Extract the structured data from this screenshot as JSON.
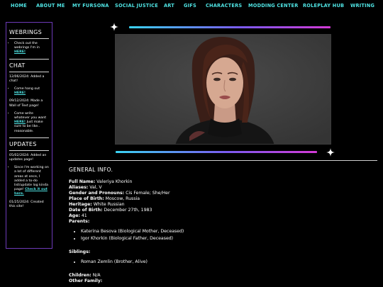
{
  "nav": {
    "items": [
      "HOME",
      "ABOUT ME",
      "MY FURSONA",
      "SOCIAL JUSTICE",
      "ART",
      "GIFS",
      "CHARACTERS",
      "MODDING CENTER",
      "ROLEPLAY HUB",
      "WRITING"
    ]
  },
  "sidebar": {
    "webrings": {
      "heading": "WEBRINGS",
      "item_text": "Check out the webrings I'm in",
      "item_link": "HERE!"
    },
    "chat": {
      "heading": "CHAT",
      "entry1_date_text": "12/06/2024: Added a chat!",
      "bullet1_text": "Come hang out",
      "bullet1_link": "HERE!",
      "entry2_date_text": "09/12/2024: Made a Wall of Text page!",
      "bullet2_text": "Come write whatever you want",
      "bullet2_link": "HERE!",
      "bullet2_text_after": "Just make sure to be like.. reasonable."
    },
    "updates": {
      "heading": "UPDATES",
      "entry1_text": "05/02/2024: Added an updates page!",
      "bullet_text": "Since I'm working on a lot of different areas at once, I added a to-do list/update log kinda page!",
      "bullet_link": "Check it out here.",
      "entry2_text": "01/25/2024: Created this site!"
    }
  },
  "info": {
    "title": "GENERAL INFO.",
    "full_name_label": "Full Name:",
    "full_name": "Valeriya Khorkin",
    "aliases_label": "Aliases:",
    "aliases": "Val, V",
    "gender_label": "Gender and Pronouns:",
    "gender": "Cis Female; She/Her",
    "birthplace_label": "Place of Birth:",
    "birthplace": "Moscow, Russia",
    "heritage_label": "Heritage:",
    "heritage": "White Russian",
    "dob_label": "Date of Birth:",
    "dob": "December 27th, 1983",
    "age_label": "Age:",
    "age": "41",
    "parents_label": "Parents:",
    "parents": [
      "Katerina Besova (Biological Mother, Deceased)",
      "Igor Khorkin (Biological Father, Deceased)"
    ],
    "siblings_label": "Siblings:",
    "siblings": [
      "Roman Zemlin (Brother, Alive)"
    ],
    "children_label": "Children:",
    "children": "N/A",
    "other_family_label": "Other Family:"
  },
  "colors": {
    "accent_cyan": "#4fe3e3",
    "sidebar_border": "#6d3ab8",
    "gradient": [
      "#3ad3f3",
      "#7a5bf0",
      "#d33ad6"
    ]
  }
}
